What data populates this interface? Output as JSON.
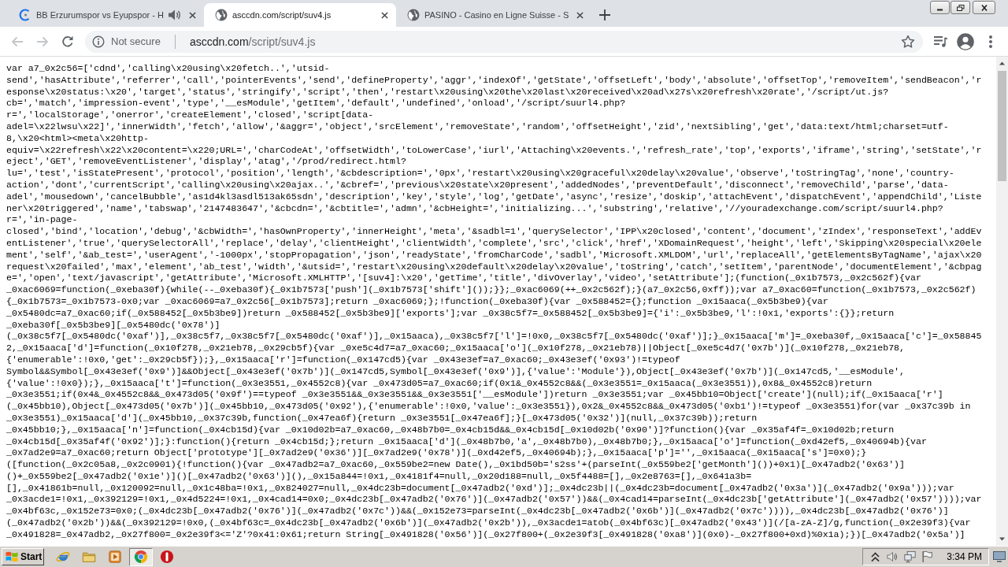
{
  "browser": {
    "tabs": [
      {
        "title": "BB Erzurumspor vs Eyupspor - H",
        "kind": "site",
        "audio": true,
        "selected": false
      },
      {
        "title": "asccdn.com/script/suv4.js",
        "kind": "page",
        "audio": false,
        "selected": true
      },
      {
        "title": "PASINO - Casino en Ligne Suisse - S",
        "kind": "page",
        "audio": false,
        "selected": false
      }
    ],
    "nav": [
      {
        "kind": "back",
        "disabled": true
      },
      {
        "kind": "forward",
        "disabled": true
      },
      {
        "kind": "reload",
        "disabled": false
      }
    ],
    "omnibox": {
      "security": "Not secure",
      "host": "asccdn.com",
      "path": "/script/suv4.js"
    }
  },
  "source": {
    "lines": [
      "var a7_0x2c56=['cdnd','calling\\x20using\\x20fetch..','utsid-",
      "send','hasAttribute','referrer','call','pointerEvents','send','defineProperty','aggr','indexOf','getState','offsetLeft','body','absolute','offsetTop','removeItem','sendBeacon','r",
      "esponse\\x20status:\\x20','target','status','stringify','script','then','restart\\x20using\\x20the\\x20last\\x20received\\x20ad\\x27s\\x20refresh\\x20rate','/script/ut.js?",
      "cb=','match','impression-event','type','__esModule','getItem','default','undefined','onload','/script/suurl4.php?",
      "r=','localStorage','onerror','createElement','closed','script[data-",
      "adel=\\x22lwsu\\x22]','innerWidth','fetch','allow','&aggr=','object','srcElement','removeState','random','offsetHeight','zid','nextSibling','get','data:text/html;charset=utf-",
      "8,\\x20<html><meta\\x20http-",
      "equiv=\\x22refresh\\x22\\x20content=\\x220;URL=','charCodeAt','offsetWidth','toLowerCase','iurl','Attaching\\x20events.','refresh_rate','top','exports','iframe','string','setState','r",
      "eject','GET','removeEventListener','display','atag','/prod/redirect.html?",
      "lu=','test','isStatePresent','protocol','position','length','&cbdescription=','0px','restart\\x20using\\x20graceful\\x20delay\\x20value','observe','toStringTag','none','country-",
      "action','dont','currentScript','calling\\x20using\\x20ajax..','&cbref=','previous\\x20state\\x20present','addedNodes','preventDefault','disconnect','removeChild','parse','data-",
      "adel','mousedown','cancelBubble','as1d4kl3asdl513ak65sdn','description','key','style','log','getDate','async','resize','doskip','attachEvent','dispatchEvent','appendChild','Liste",
      "ner\\x20triggered','name','tabswap','2147483647','&cbcdn=','&cbtitle=','admn','&cbHeight=','initializing...','substring','relative','//youradexchange.com/script/suurl4.php?",
      "r=','in-page-",
      "closed','bind','location','debug','&cbWidth=','hasOwnProperty','innerHeight','meta','&sadbl=1','querySelector','IPP\\x20closed','content','document','zIndex','responseText','addEv",
      "entListener','true','querySelectorAll','replace','delay','clientHeight','clientWidth','complete','src','click','href','XDomainRequest','height','left','Skipping\\x20special\\x20ele",
      "ment','self','&ab_test=','userAgent','-1000px','stopPropagation','json','readyState','fromCharCode','sadbl','Microsoft.XMLDOM','url','replaceAll','getElementsByTagName','ajax\\x20",
      "request\\x20failed','max','element','ab_test','width','&utsid=','restart\\x20using\\x20default\\x20delay\\x20value','toString','catch','setItem','parentNode','documentElement','&cbpag",
      "e=','open','text/javascript','getAttribute','Microsoft.XMLHTTP','[suv4]:\\x20','getTime','title','divOverlay','video','setAttribute'];(function(_0x1b7573,_0x2c562f){var",
      "_0xac6069=function(_0xeba30f){while(--_0xeba30f){_0x1b7573['push'](_0x1b7573['shift']());}};_0xac6069(++_0x2c562f);}(a7_0x2c56,0xff));var a7_0xac60=function(_0x1b7573,_0x2c562f)",
      "{_0x1b7573=_0x1b7573-0x0;var _0xac6069=a7_0x2c56[_0x1b7573];return _0xac6069;};!function(_0xeba30f){var _0x588452={};function _0x15aaca(_0x5b3be9){var",
      "_0x5480dc=a7_0xac60;if(_0x588452[_0x5b3be9])return _0x588452[_0x5b3be9]['exports'];var _0x38c5f7=_0x588452[_0x5b3be9]={'i':_0x5b3be9,'l':!0x1,'exports':{}};return",
      "_0xeba30f[_0x5b3be9][_0x5480dc('0x78')]",
      "(_0x38c5f7[_0x5480dc('0xaf')],_0x38c5f7,_0x38c5f7[_0x5480dc('0xaf')],_0x15aaca),_0x38c5f7['l']=!0x0,_0x38c5f7[_0x5480dc('0xaf')];}_0x15aaca['m']=_0xeba30f,_0x15aaca['c']=_0x58845",
      "2,_0x15aaca['d']=function(_0x10f278,_0x21eb78,_0x29cb5f){var _0xe5c4d7=a7_0xac60;_0x15aaca['o'](_0x10f278,_0x21eb78)||Object[_0xe5c4d7('0x7b')](_0x10f278,_0x21eb78,",
      "{'enumerable':!0x0,'get':_0x29cb5f});},_0x15aaca['r']=function(_0x147cd5){var _0x43e3ef=a7_0xac60;_0x43e3ef('0x93')!=typeof",
      "Symbol&&Symbol[_0x43e3ef('0x9')]&&Object[_0x43e3ef('0x7b')](_0x147cd5,Symbol[_0x43e3ef('0x9')],{'value':'Module'}),Object[_0x43e3ef('0x7b')](_0x147cd5,'__esModule',",
      "{'value':!0x0});},_0x15aaca['t']=function(_0x3e3551,_0x4552c8){var _0x473d05=a7_0xac60;if(0x1&_0x4552c8&&(_0x3e3551=_0x15aaca(_0x3e3551)),0x8&_0x4552c8)return",
      "_0x3e3551;if(0x4&_0x4552c8&&_0x473d05('0x9f')==typeof _0x3e3551&&_0x3e3551&&_0x3e3551['__esModule'])return _0x3e3551;var _0x45bb10=Object['create'](null);if(_0x15aaca['r']",
      "(_0x45bb10),Object[_0x473d05('0x7b')](_0x45bb10,_0x473d05('0x92'),{'enumerable':!0x0,'value':_0x3e3551}),0x2&_0x4552c8&&_0x473d05('0xb1')!=typeof _0x3e3551)for(var _0x37c39b in",
      "_0x3e3551)_0x15aaca['d'](_0x45bb10,_0x37c39b,function(_0x47ea6f){return _0x3e3551[_0x47ea6f];}[_0x473d05('0x32')](null,_0x37c39b));return",
      "_0x45bb10;},_0x15aaca['n']=function(_0x4cb15d){var _0x10d02b=a7_0xac60,_0x48b7b0=_0x4cb15d&&_0x4cb15d[_0x10d02b('0x90')]?function(){var _0x35af4f=_0x10d02b;return",
      "_0x4cb15d[_0x35af4f('0x92')];}:function(){return _0x4cb15d;};return _0x15aaca['d'](_0x48b7b0,'a',_0x48b7b0),_0x48b7b0;},_0x15aaca['o']=function(_0xd42ef5,_0x40694b){var",
      "_0x7ad2e9=a7_0xac60;return Object['prototype'][_0x7ad2e9('0x36')][_0x7ad2e9('0x78')](_0xd42ef5,_0x40694b);},_0x15aaca['p']='',_0x15aaca(_0x15aaca['s']=0x0);}",
      "([function(_0x2c05a8,_0x2c0901){!function(){var _0x47adb2=a7_0xac60,_0x559be2=new Date(),_0x1bd50b='s2ss'+(parseInt(_0x559be2['getMonth']())+0x1)[_0x47adb2('0x63')]",
      "()+_0x559be2[_0x47adb2('0x1e')]()[_0x47adb2('0x63')](),_0x15a844=!0x1,_0x4181f4=null,_0x20d188=null,_0x5f4488=[],_0x2e8763=[],_0x641a3b=",
      "[],_0x41861b=null,_0x120092=null,_0x1c48ba=!0x1,_0x824027=null,_0x4dc23b=document[_0x47adb2('0xd')];_0x4dc23b||(_0x4dc23b=document[_0x47adb2('0x3a')](_0x47adb2('0x9a')));var",
      "_0x3acde1=!0x1,_0x392129=!0x1,_0x4d5224=!0x1,_0x4cad14=0x0;_0x4dc23b[_0x47adb2('0x76')](_0x47adb2('0x57'))&&(_0x4cad14=parseInt(_0x4dc23b['getAttribute'](_0x47adb2('0x57'))));var",
      "_0x4bf63c,_0x152e73=0x0;(_0x4dc23b[_0x47adb2('0x76')](_0x47adb2('0x7c'))&&(_0x152e73=parseInt(_0x4dc23b[_0x47adb2('0x6b')](_0x47adb2('0x7c')))),_0x4dc23b[_0x47adb2('0x76')]",
      "(_0x47adb2('0x2b'))&&(_0x392129=!0x0,(_0x4bf63c=_0x4dc23b[_0x47adb2('0x6b')](_0x47adb2('0x2b')),_0x3acde1=atob(_0x4bf63c)[_0x47adb2('0x43')](/[a-zA-Z]/g,function(_0x2e39f3){var",
      "_0x491828=_0x47adb2,_0x27f800=_0x2e39f3<='Z'?0x41:0x61;return String[_0x491828('0x56')](_0x27f800+(_0x2e39f3[_0x491828('0xa8')](0x0)-_0x27f800+0xd)%0x1a);})[_0x47adb2('0x5a')]"
    ]
  },
  "taskbar": {
    "start": "Start",
    "apps": [
      {
        "kind": "orbit",
        "selected": false
      },
      {
        "kind": "folder",
        "selected": false
      },
      {
        "kind": "player",
        "selected": false
      },
      {
        "kind": "wheel",
        "selected": true
      },
      {
        "kind": "ring",
        "selected": false
      }
    ],
    "clock": "3:34 PM"
  }
}
